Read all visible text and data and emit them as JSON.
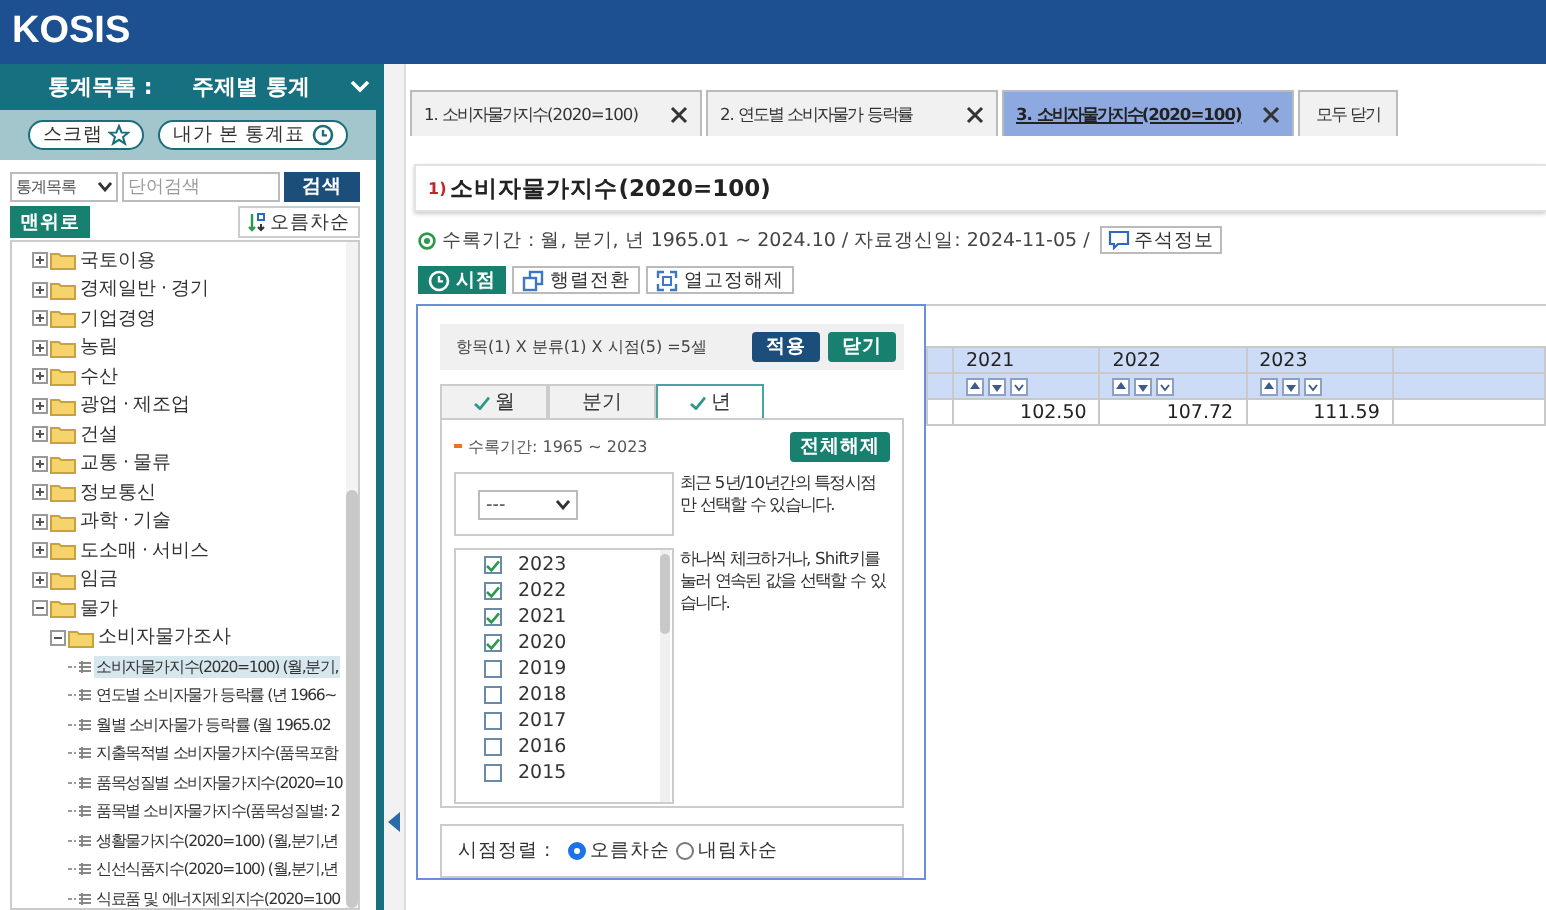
{
  "header": {
    "logo": "KOSIS"
  },
  "sidebar": {
    "label": "통계목록 :",
    "selection": "주제별 통계",
    "buttons": [
      {
        "label": "스크랩",
        "kind": "star"
      },
      {
        "label": "내가 본 통계표",
        "kind": "clock"
      }
    ],
    "search": {
      "scope": "통계목록",
      "placeholder": "단어검색",
      "button": "검색"
    },
    "top_button": "맨위로",
    "sort_button": "오름차순",
    "tree": [
      {
        "label": "국토이용",
        "kind": "folder",
        "expanded": false,
        "selected": false
      },
      {
        "label": "경제일반 · 경기",
        "kind": "folder",
        "expanded": false,
        "selected": false
      },
      {
        "label": "기업경영",
        "kind": "folder",
        "expanded": false,
        "selected": false
      },
      {
        "label": "농림",
        "kind": "folder",
        "expanded": false,
        "selected": false
      },
      {
        "label": "수산",
        "kind": "folder",
        "expanded": false,
        "selected": false
      },
      {
        "label": "광업 · 제조업",
        "kind": "folder",
        "expanded": false,
        "selected": false
      },
      {
        "label": "건설",
        "kind": "folder",
        "expanded": false,
        "selected": false
      },
      {
        "label": "교통 · 물류",
        "kind": "folder",
        "expanded": false,
        "selected": false
      },
      {
        "label": "정보통신",
        "kind": "folder",
        "expanded": false,
        "selected": false
      },
      {
        "label": "과학 · 기술",
        "kind": "folder",
        "expanded": false,
        "selected": false
      },
      {
        "label": "도소매 · 서비스",
        "kind": "folder",
        "expanded": false,
        "selected": false
      },
      {
        "label": "임금",
        "kind": "folder",
        "expanded": false,
        "selected": false
      },
      {
        "label": "물가",
        "kind": "folder",
        "expanded": true,
        "selected": false,
        "children": [
          {
            "label": "소비자물가조사",
            "kind": "folder",
            "expanded": true,
            "selected": false,
            "children": [
              {
                "label": "소비자물가지수(2020=100) (월,분기,",
                "kind": "table",
                "selected": true
              },
              {
                "label": "연도별 소비자물가 등락률 (년 1966~",
                "kind": "table",
                "selected": false
              },
              {
                "label": "월별 소비자물가 등락률 (월 1965.02",
                "kind": "table",
                "selected": false
              },
              {
                "label": "지출목적별 소비자물가지수(품목포함",
                "kind": "table",
                "selected": false
              },
              {
                "label": "품목성질별 소비자물가지수(2020=10",
                "kind": "table",
                "selected": false
              },
              {
                "label": "품목별 소비자물가지수(품목성질별: 2",
                "kind": "table",
                "selected": false
              },
              {
                "label": "생활물가지수(2020=100) (월,분기,년",
                "kind": "table",
                "selected": false
              },
              {
                "label": "신선식품지수(2020=100) (월,분기,년",
                "kind": "table",
                "selected": false
              },
              {
                "label": "식료품 및 에너지제외지수(2020=100",
                "kind": "table",
                "selected": false
              }
            ]
          }
        ]
      }
    ]
  },
  "tabs": [
    {
      "label": "1. 소비자물가지수(2020=100)",
      "selected": false
    },
    {
      "label": "2. 연도별 소비자물가 등락률",
      "selected": false
    },
    {
      "label": "3. 소비자물가지수(2020=100)",
      "selected": true
    }
  ],
  "close_all": "모두 닫기",
  "title": "$^{1)}$ 소비자물가지수(2020=100)",
  "info": "수록기간 : 월, 분기, 년 1965.01 ~ 2024.10 / 자료갱신일: 2024-11-05 /",
  "notes_button": "주석정보",
  "toolbar": [
    {
      "label": "시점",
      "kind": "clock",
      "selected": true
    },
    {
      "label": "행렬전환",
      "kind": "swap",
      "selected": false
    },
    {
      "label": "열고정해제",
      "kind": "unfreeze",
      "selected": false
    }
  ],
  "table": {
    "columns": [
      "2021",
      "2022",
      "2023"
    ],
    "rows": [
      [
        "102.50",
        "107.72",
        "111.59"
      ]
    ]
  },
  "popup": {
    "summary": "항목(1) X 분류(1) X 시점(5) =5셀",
    "apply_button": "적용",
    "close_button": "닫기",
    "tabs": [
      {
        "label": "월",
        "checked": true,
        "selected": false
      },
      {
        "label": "분기",
        "checked": false,
        "selected": false
      },
      {
        "label": "년",
        "checked": true,
        "selected": true
      }
    ],
    "period": "수록기간: 1965 ~ 2023",
    "clear_button": "전체해제",
    "preset": {
      "value": "---"
    },
    "preset_hint": "최근 5년/10년간의 특정시점만 선택할 수 있습니다.",
    "years": [
      {
        "label": "2023",
        "checked": true
      },
      {
        "label": "2022",
        "checked": true
      },
      {
        "label": "2021",
        "checked": true
      },
      {
        "label": "2020",
        "checked": true
      },
      {
        "label": "2019",
        "checked": false
      },
      {
        "label": "2018",
        "checked": false
      },
      {
        "label": "2017",
        "checked": false
      },
      {
        "label": "2016",
        "checked": false
      },
      {
        "label": "2015",
        "checked": false
      }
    ],
    "years_hint": "하나씩 체크하거나, Shift키를 눌러 연속된 값을 선택할 수 있습니다.",
    "sort_label": "시점정렬 :",
    "sort_options": [
      {
        "label": "오름차순",
        "selected": true
      },
      {
        "label": "내림차순",
        "selected": false
      }
    ]
  }
}
